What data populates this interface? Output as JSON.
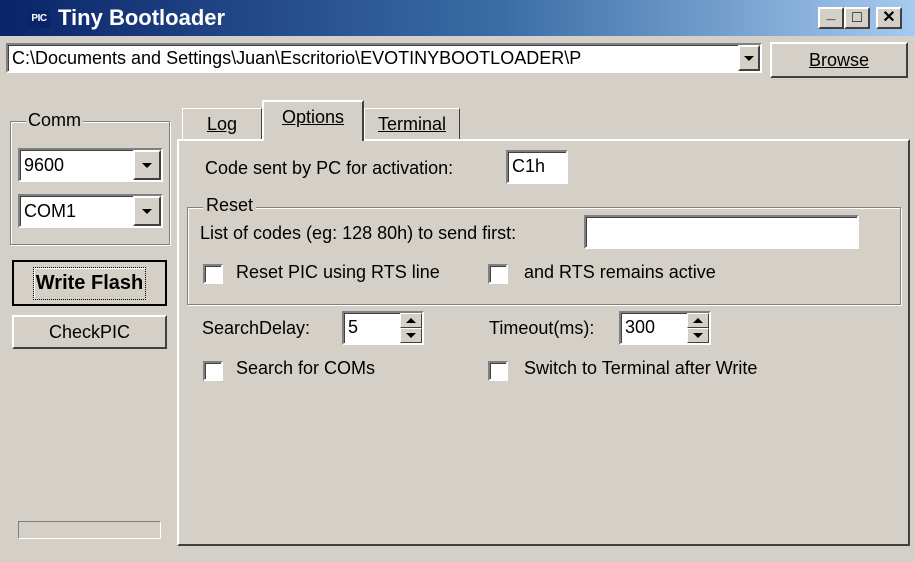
{
  "window": {
    "title": "Tiny Bootloader",
    "icon_label": "PIC",
    "minimize_glyph": "_",
    "maximize_glyph": "□",
    "close_glyph": "✕"
  },
  "path_combo": {
    "value": "C:\\Documents and Settings\\Juan\\Escritorio\\EVOTINYBOOTLOADER\\P"
  },
  "browse_button": {
    "label": "Browse"
  },
  "comm": {
    "legend": "Comm",
    "baud": "9600",
    "port": "COM1"
  },
  "write_flash_button": {
    "label": "Write Flash"
  },
  "checkpic_button": {
    "label": "CheckPIC"
  },
  "tabs": [
    {
      "label": "Log",
      "active": false
    },
    {
      "label": "Options",
      "active": true
    },
    {
      "label": "Terminal",
      "active": false
    }
  ],
  "options": {
    "activation_label": "Code sent by PC for activation:",
    "activation_value": "C1h",
    "reset_legend": "Reset",
    "codes_label": "List of codes (eg: 128  80h) to send first:",
    "codes_value": "",
    "reset_rts_label": "Reset PIC using RTS line",
    "rts_active_label": "and RTS remains active",
    "search_delay_label": "SearchDelay:",
    "search_delay_value": "5",
    "timeout_label": "Timeout(ms):",
    "timeout_value": "300",
    "search_coms_label": "Search for COMs",
    "switch_terminal_label": "Switch to Terminal after Write"
  }
}
